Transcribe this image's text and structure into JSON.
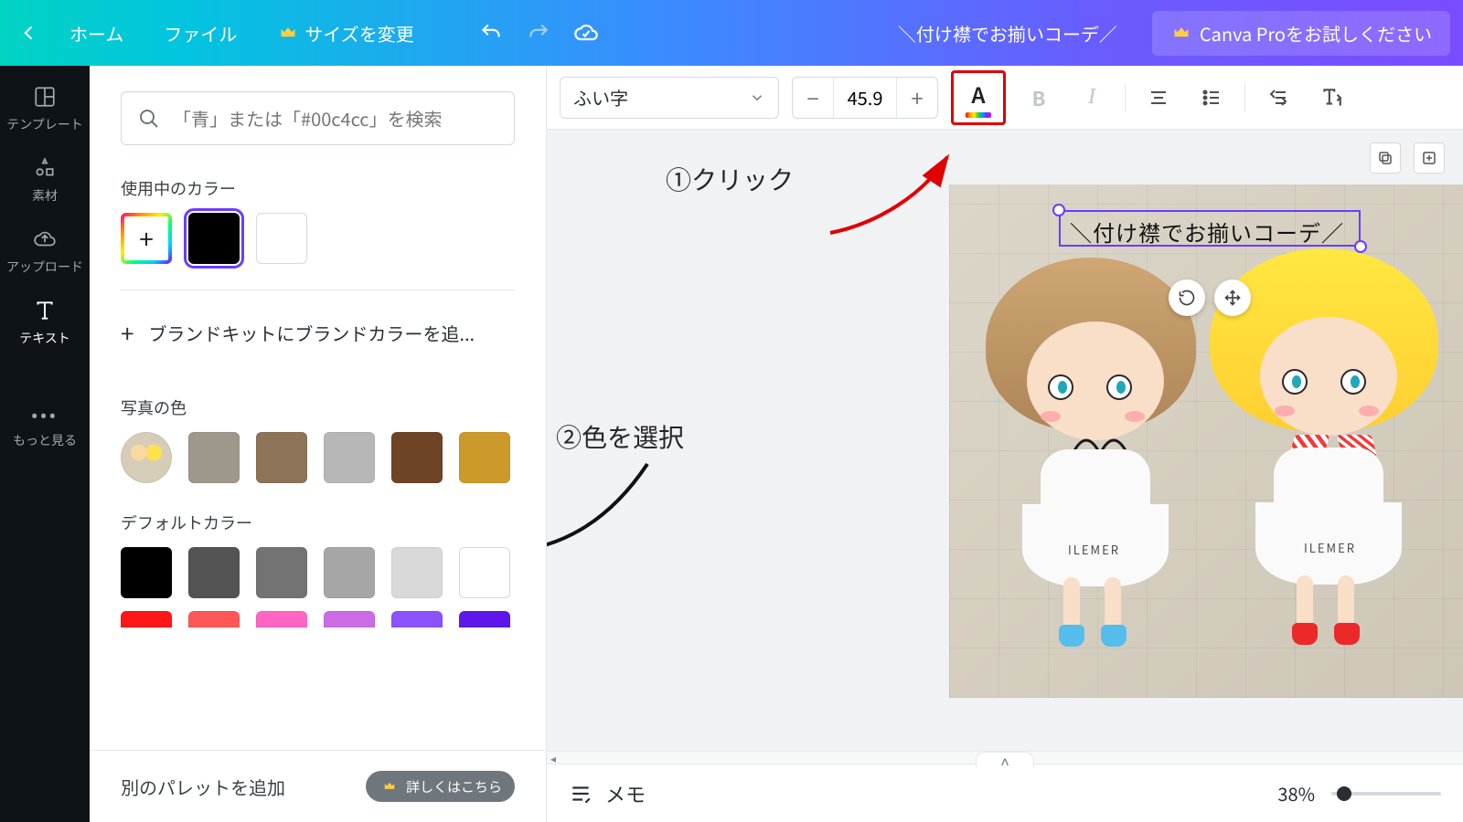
{
  "topbar": {
    "home": "ホーム",
    "file": "ファイル",
    "resize": "サイズを変更",
    "doc_title": "＼付け襟でお揃いコーデ／",
    "try_pro": "Canva Proをお試しください"
  },
  "rail": {
    "templates": "テンプレート",
    "elements": "素材",
    "uploads": "アップロード",
    "text": "テキスト",
    "more": "もっと見る"
  },
  "panel": {
    "search_placeholder": "「青」または「#00c4cc」を検索",
    "in_use": "使用中のカラー",
    "brand_add": "ブランドキットにブランドカラーを追...",
    "photo_colors": "写真の色",
    "default_colors": "デフォルトカラー",
    "footer_label": "別のパレットを追加",
    "footer_pill": "詳しくはこちら",
    "photo_swatches": [
      "#9e978c",
      "#8d7357",
      "#b7b7b7",
      "#6f4326",
      "#cc9a2a"
    ],
    "default_row1": [
      "#000000",
      "#545454",
      "#737373",
      "#a6a6a6",
      "#d9d9d9",
      "#ffffff"
    ],
    "default_row2": [
      "#ff1616",
      "#ff5757",
      "#ff66c4",
      "#cb6ce6",
      "#8c52ff",
      "#5e17eb"
    ]
  },
  "toolbar": {
    "font": "ふい字",
    "size": "45.9"
  },
  "design": {
    "text": "＼付け襟でお揃いコーデ／",
    "doll_tag": "ILEMER"
  },
  "annotations": {
    "click": "①クリック",
    "choose": "②色を選択"
  },
  "footer": {
    "notes": "メモ",
    "zoom": "38%"
  }
}
